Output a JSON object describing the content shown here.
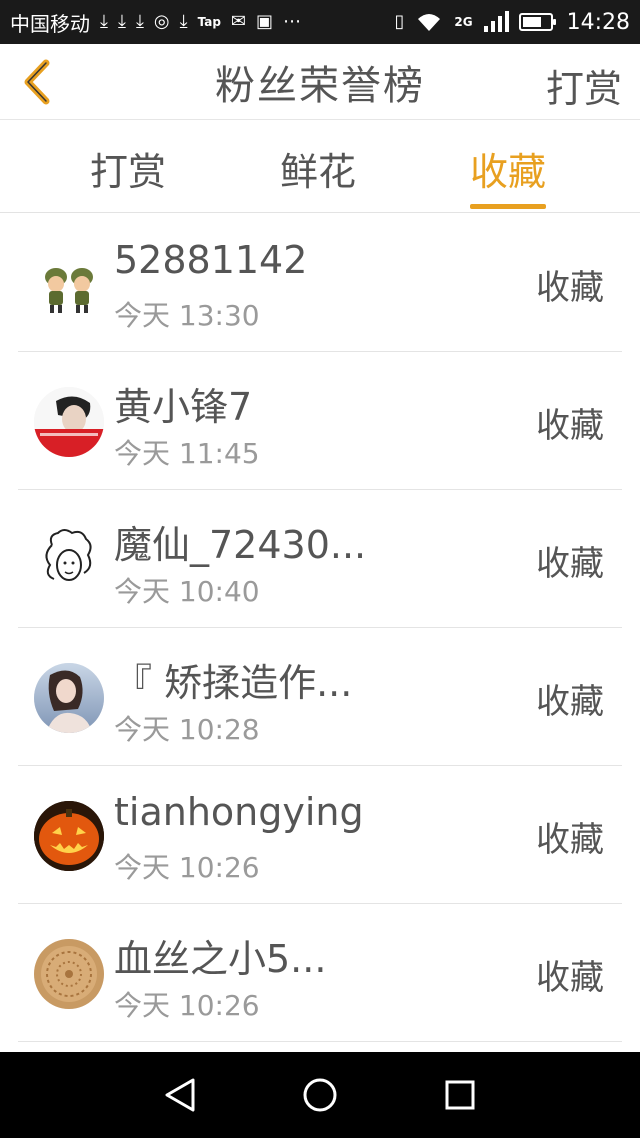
{
  "status_bar": {
    "carrier": "中国移动",
    "tap_label": "Tap",
    "network_label": "2G",
    "time": "14:28"
  },
  "header": {
    "title": "粉丝荣誉榜",
    "right_action": "打赏"
  },
  "tabs": [
    {
      "label": "打赏",
      "active": false
    },
    {
      "label": "鲜花",
      "active": false
    },
    {
      "label": "收藏",
      "active": true
    }
  ],
  "colors": {
    "accent": "#e8a020",
    "text": "#555555",
    "subtext": "#9a9a9a"
  },
  "list": [
    {
      "name": "52881142",
      "time": "今天 13:30",
      "action": "收藏",
      "avatar_icon": "soldier-dolls-avatar"
    },
    {
      "name": "黄小锋7",
      "time": "今天 11:45",
      "action": "收藏",
      "avatar_icon": "portrait-avatar"
    },
    {
      "name": "魔仙_72430...",
      "time": "今天 10:40",
      "action": "收藏",
      "avatar_icon": "sketch-face-avatar"
    },
    {
      "name": "『 矫揉造作...",
      "time": "今天 10:28",
      "action": "收藏",
      "avatar_icon": "girl-photo-avatar"
    },
    {
      "name": "tianhongying",
      "time": "今天 10:26",
      "action": "收藏",
      "avatar_icon": "pumpkin-avatar"
    },
    {
      "name": "血丝之小5...",
      "time": "今天 10:26",
      "action": "收藏",
      "avatar_icon": "cookie-avatar"
    }
  ]
}
